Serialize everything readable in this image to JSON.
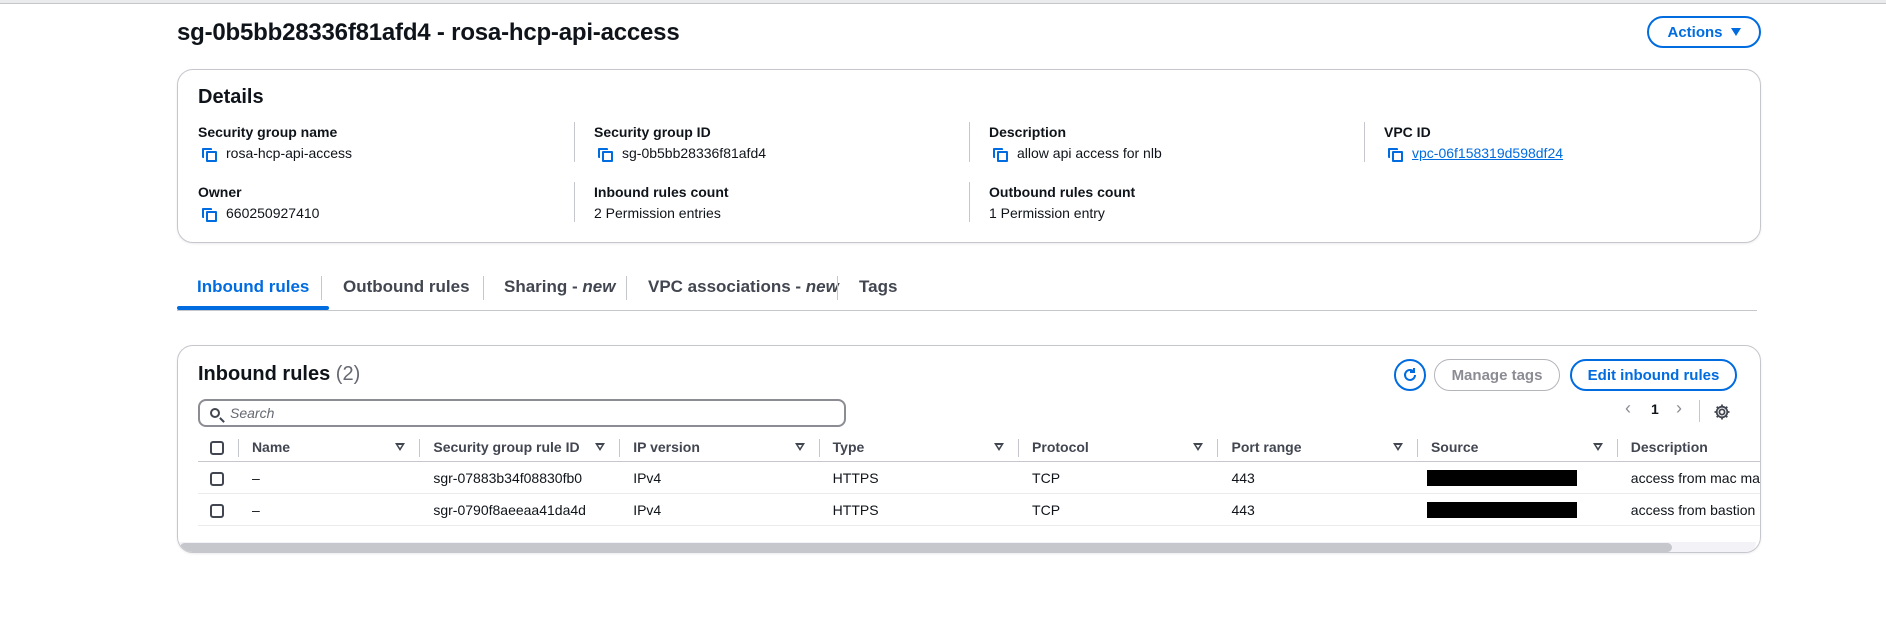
{
  "header": {
    "title": "sg-0b5bb28336f81afd4 - rosa-hcp-api-access",
    "actions_label": "Actions"
  },
  "details": {
    "title": "Details",
    "security_group_name": {
      "label": "Security group name",
      "value": "rosa-hcp-api-access"
    },
    "security_group_id": {
      "label": "Security group ID",
      "value": "sg-0b5bb28336f81afd4"
    },
    "description": {
      "label": "Description",
      "value": "allow api access for nlb"
    },
    "vpc_id": {
      "label": "VPC ID",
      "value": "vpc-06f158319d598df24"
    },
    "owner": {
      "label": "Owner",
      "value": "660250927410"
    },
    "inbound_count": {
      "label": "Inbound rules count",
      "value": "2 Permission entries"
    },
    "outbound_count": {
      "label": "Outbound rules count",
      "value": "1 Permission entry"
    }
  },
  "tabs": [
    {
      "label": "Inbound rules",
      "suffix": ""
    },
    {
      "label": "Outbound rules",
      "suffix": ""
    },
    {
      "label": "Sharing - ",
      "suffix": "new"
    },
    {
      "label": "VPC associations - ",
      "suffix": "new"
    },
    {
      "label": "Tags",
      "suffix": ""
    }
  ],
  "inbound": {
    "title": "Inbound rules",
    "count": "(2)",
    "manage_tags_label": "Manage tags",
    "edit_label": "Edit inbound rules",
    "search_placeholder": "Search",
    "page": "1",
    "columns": [
      "Name",
      "Security group rule ID",
      "IP version",
      "Type",
      "Protocol",
      "Port range",
      "Source",
      "Description"
    ],
    "rows": [
      {
        "name": "–",
        "rule_id": "sgr-07883b34f08830fb0",
        "ip_version": "IPv4",
        "type": "HTTPS",
        "protocol": "TCP",
        "port_range": "443",
        "description": "access from mac ma"
      },
      {
        "name": "–",
        "rule_id": "sgr-0790f8aeeaa41da4d",
        "ip_version": "IPv4",
        "type": "HTTPS",
        "protocol": "TCP",
        "port_range": "443",
        "description": "access from bastion"
      }
    ]
  }
}
